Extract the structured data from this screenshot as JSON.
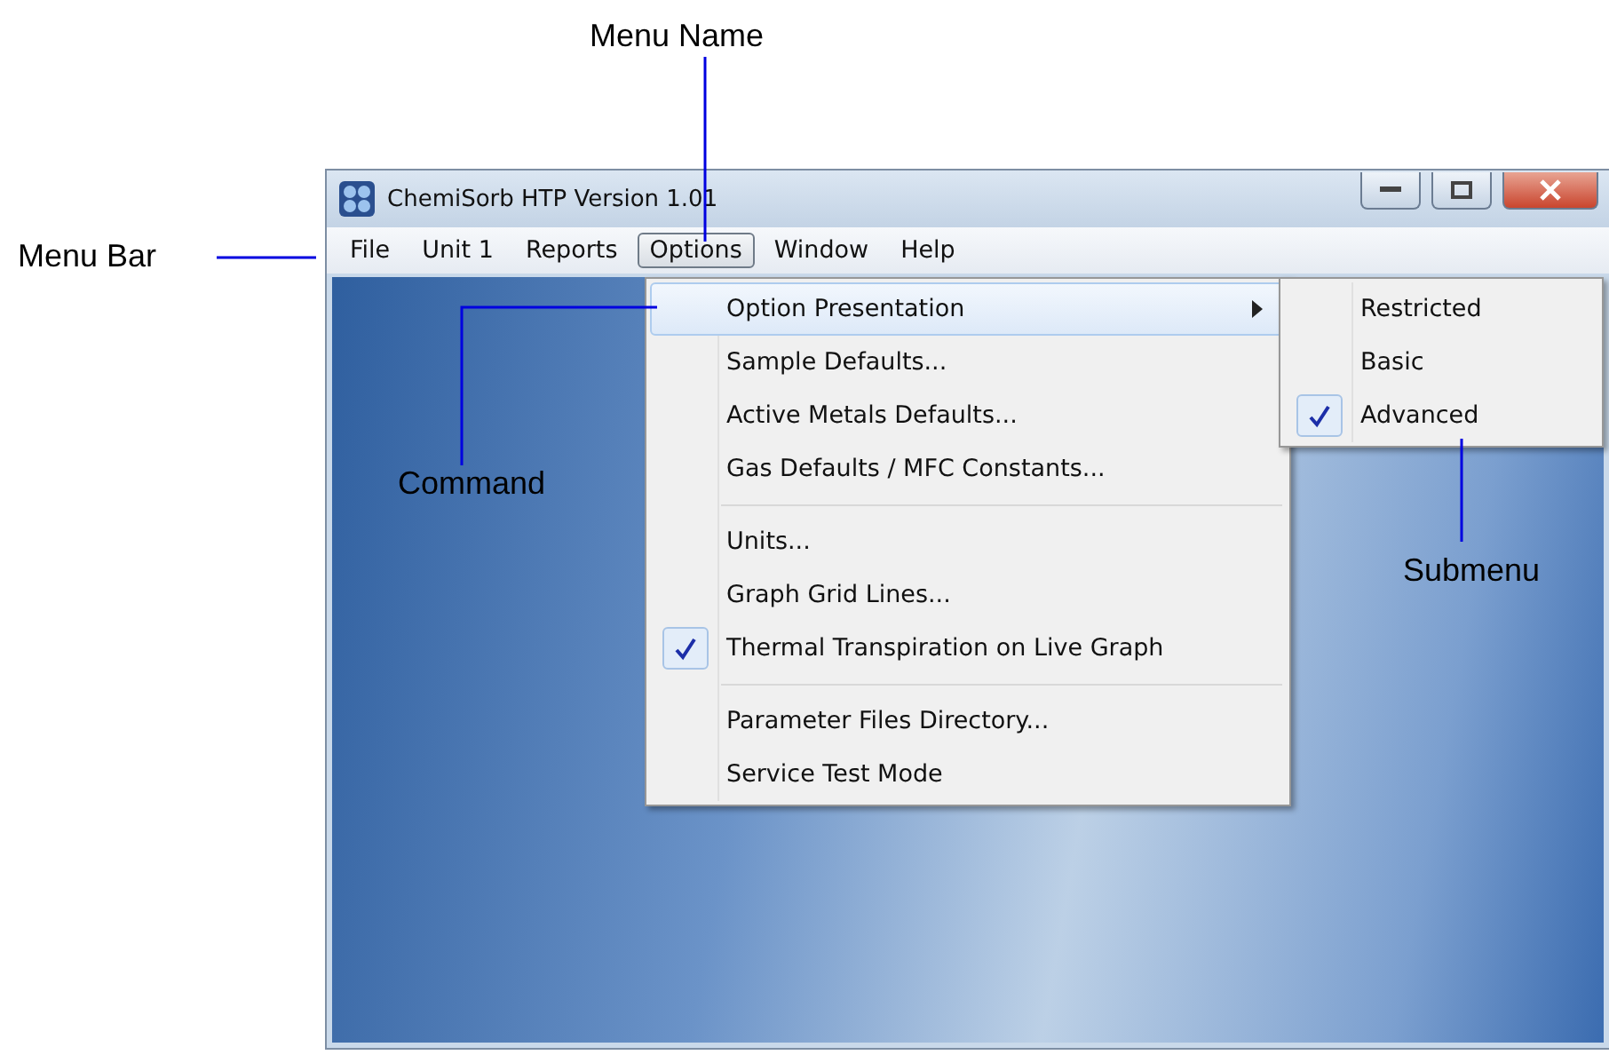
{
  "callouts": [
    {
      "kind": "top",
      "label": "Menu Name"
    },
    {
      "kind": "left",
      "label": "Menu Bar"
    },
    {
      "kind": "elbow",
      "label": "Command"
    },
    {
      "kind": "below",
      "label": "Submenu"
    }
  ],
  "window": {
    "title": "ChemiSorb HTP Version 1.01"
  },
  "menu_bar": [
    {
      "label": "File",
      "selected": false
    },
    {
      "label": "Unit 1",
      "selected": false
    },
    {
      "label": "Reports",
      "selected": false
    },
    {
      "label": "Options",
      "selected": true
    },
    {
      "label": "Window",
      "selected": false
    },
    {
      "label": "Help",
      "selected": false
    }
  ],
  "menu": [
    {
      "items": [
        {
          "label": "Option Presentation",
          "selected": true,
          "checked": false,
          "submenu": true
        },
        {
          "label": "Sample Defaults...",
          "selected": false,
          "checked": false,
          "submenu": false
        },
        {
          "label": "Active Metals Defaults...",
          "selected": false,
          "checked": false,
          "submenu": false
        },
        {
          "label": "Gas Defaults / MFC Constants...",
          "selected": false,
          "checked": false,
          "submenu": false
        }
      ]
    },
    {
      "items": [
        {
          "label": "Units...",
          "selected": false,
          "checked": false,
          "submenu": false
        },
        {
          "label": "Graph Grid Lines...",
          "selected": false,
          "checked": false,
          "submenu": false
        },
        {
          "label": "Thermal Transpiration on Live Graph",
          "selected": false,
          "checked": true,
          "submenu": false
        }
      ]
    },
    {
      "items": [
        {
          "label": "Parameter Files Directory...",
          "selected": false,
          "checked": false,
          "submenu": false
        },
        {
          "label": "Service Test Mode",
          "selected": false,
          "checked": false,
          "submenu": false
        }
      ]
    }
  ],
  "submenu": [
    {
      "label": "Restricted",
      "checked": false
    },
    {
      "label": "Basic",
      "checked": false
    },
    {
      "label": "Advanced",
      "checked": true
    }
  ]
}
